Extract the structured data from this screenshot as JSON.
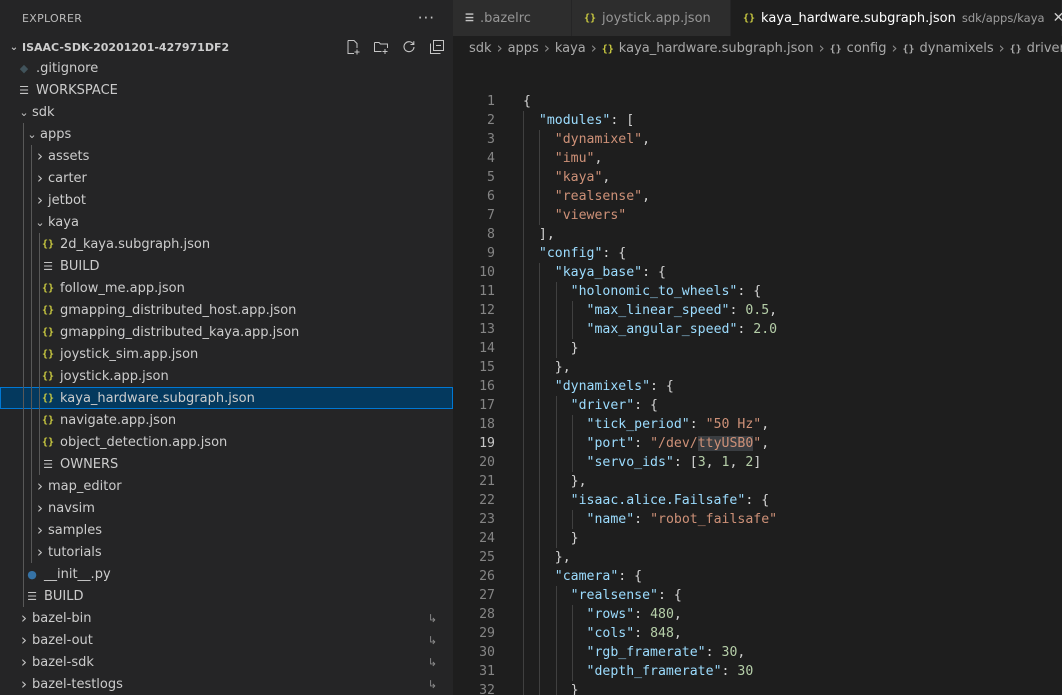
{
  "explorer": {
    "title": "EXPLORER",
    "more_icon": "ellipsis-icon",
    "root": "ISAAC-SDK-20201201-427971DF2",
    "actions": [
      "new-file-icon",
      "new-folder-icon",
      "refresh-icon",
      "collapse-all-icon"
    ],
    "items": [
      {
        "label": ".gitignore",
        "depth": 1,
        "type": "file",
        "icon": "git"
      },
      {
        "label": "WORKSPACE",
        "depth": 1,
        "type": "file",
        "icon": "lines"
      },
      {
        "label": "sdk",
        "depth": 1,
        "type": "folder-open"
      },
      {
        "label": "apps",
        "depth": 2,
        "type": "folder-open"
      },
      {
        "label": "assets",
        "depth": 3,
        "type": "folder"
      },
      {
        "label": "carter",
        "depth": 3,
        "type": "folder"
      },
      {
        "label": "jetbot",
        "depth": 3,
        "type": "folder"
      },
      {
        "label": "kaya",
        "depth": 3,
        "type": "folder-open"
      },
      {
        "label": "2d_kaya.subgraph.json",
        "depth": 4,
        "type": "file",
        "icon": "json"
      },
      {
        "label": "BUILD",
        "depth": 4,
        "type": "file",
        "icon": "lines"
      },
      {
        "label": "follow_me.app.json",
        "depth": 4,
        "type": "file",
        "icon": "json"
      },
      {
        "label": "gmapping_distributed_host.app.json",
        "depth": 4,
        "type": "file",
        "icon": "json"
      },
      {
        "label": "gmapping_distributed_kaya.app.json",
        "depth": 4,
        "type": "file",
        "icon": "json"
      },
      {
        "label": "joystick_sim.app.json",
        "depth": 4,
        "type": "file",
        "icon": "json"
      },
      {
        "label": "joystick.app.json",
        "depth": 4,
        "type": "file",
        "icon": "json"
      },
      {
        "label": "kaya_hardware.subgraph.json",
        "depth": 4,
        "type": "file",
        "icon": "json",
        "selected": true
      },
      {
        "label": "navigate.app.json",
        "depth": 4,
        "type": "file",
        "icon": "json"
      },
      {
        "label": "object_detection.app.json",
        "depth": 4,
        "type": "file",
        "icon": "json"
      },
      {
        "label": "OWNERS",
        "depth": 4,
        "type": "file",
        "icon": "lines"
      },
      {
        "label": "map_editor",
        "depth": 3,
        "type": "folder"
      },
      {
        "label": "navsim",
        "depth": 3,
        "type": "folder"
      },
      {
        "label": "samples",
        "depth": 3,
        "type": "folder"
      },
      {
        "label": "tutorials",
        "depth": 3,
        "type": "folder"
      },
      {
        "label": "__init__.py",
        "depth": 2,
        "type": "file",
        "icon": "py"
      },
      {
        "label": "BUILD",
        "depth": 2,
        "type": "file",
        "icon": "lines"
      },
      {
        "label": "bazel-bin",
        "depth": 1,
        "type": "folder",
        "link": true
      },
      {
        "label": "bazel-out",
        "depth": 1,
        "type": "folder",
        "link": true
      },
      {
        "label": "bazel-sdk",
        "depth": 1,
        "type": "folder",
        "link": true
      },
      {
        "label": "bazel-testlogs",
        "depth": 1,
        "type": "folder",
        "link": true
      }
    ]
  },
  "tabs": [
    {
      "label": ".bazelrc",
      "icon": "lines",
      "active": false
    },
    {
      "label": "joystick.app.json",
      "icon": "json",
      "active": false
    },
    {
      "label": "kaya_hardware.subgraph.json",
      "icon": "json",
      "active": true,
      "description": "sdk/apps/kaya"
    }
  ],
  "breadcrumb": [
    {
      "label": "sdk"
    },
    {
      "label": "apps"
    },
    {
      "label": "kaya"
    },
    {
      "label": "kaya_hardware.subgraph.json",
      "icon": "{}"
    },
    {
      "label": "config",
      "icon": "{}",
      "sym": true
    },
    {
      "label": "dynamixels",
      "icon": "{}",
      "sym": true
    },
    {
      "label": "driver",
      "icon": "{}",
      "sym": true
    }
  ],
  "current_line": 19,
  "code": [
    [
      [
        "p",
        "{"
      ]
    ],
    [
      [
        "p",
        "  "
      ],
      [
        "k",
        "\"modules\""
      ],
      [
        "p",
        ": ["
      ]
    ],
    [
      [
        "p",
        "    "
      ],
      [
        "s",
        "\"dynamixel\""
      ],
      [
        "p",
        ","
      ]
    ],
    [
      [
        "p",
        "    "
      ],
      [
        "s",
        "\"imu\""
      ],
      [
        "p",
        ","
      ]
    ],
    [
      [
        "p",
        "    "
      ],
      [
        "s",
        "\"kaya\""
      ],
      [
        "p",
        ","
      ]
    ],
    [
      [
        "p",
        "    "
      ],
      [
        "s",
        "\"realsense\""
      ],
      [
        "p",
        ","
      ]
    ],
    [
      [
        "p",
        "    "
      ],
      [
        "s",
        "\"viewers\""
      ]
    ],
    [
      [
        "p",
        "  ],"
      ]
    ],
    [
      [
        "p",
        "  "
      ],
      [
        "k",
        "\"config\""
      ],
      [
        "p",
        ": {"
      ]
    ],
    [
      [
        "p",
        "    "
      ],
      [
        "k",
        "\"kaya_base\""
      ],
      [
        "p",
        ": {"
      ]
    ],
    [
      [
        "p",
        "      "
      ],
      [
        "k",
        "\"holonomic_to_wheels\""
      ],
      [
        "p",
        ": {"
      ]
    ],
    [
      [
        "p",
        "        "
      ],
      [
        "k",
        "\"max_linear_speed\""
      ],
      [
        "p",
        ": "
      ],
      [
        "n",
        "0.5"
      ],
      [
        "p",
        ","
      ]
    ],
    [
      [
        "p",
        "        "
      ],
      [
        "k",
        "\"max_angular_speed\""
      ],
      [
        "p",
        ": "
      ],
      [
        "n",
        "2.0"
      ]
    ],
    [
      [
        "p",
        "      }"
      ]
    ],
    [
      [
        "p",
        "    },"
      ]
    ],
    [
      [
        "p",
        "    "
      ],
      [
        "k",
        "\"dynamixels\""
      ],
      [
        "p",
        ": {"
      ]
    ],
    [
      [
        "p",
        "      "
      ],
      [
        "k",
        "\"driver\""
      ],
      [
        "p",
        ": {"
      ]
    ],
    [
      [
        "p",
        "        "
      ],
      [
        "k",
        "\"tick_period\""
      ],
      [
        "p",
        ": "
      ],
      [
        "s",
        "\"50 Hz\""
      ],
      [
        "p",
        ","
      ]
    ],
    [
      [
        "p",
        "        "
      ],
      [
        "k",
        "\"port\""
      ],
      [
        "p",
        ": "
      ],
      [
        "s",
        "\"/dev/"
      ],
      [
        "hl",
        "ttyUSB0"
      ],
      [
        "s",
        "\""
      ],
      [
        "p",
        ","
      ]
    ],
    [
      [
        "p",
        "        "
      ],
      [
        "k",
        "\"servo_ids\""
      ],
      [
        "p",
        ": ["
      ],
      [
        "n",
        "3"
      ],
      [
        "p",
        ", "
      ],
      [
        "n",
        "1"
      ],
      [
        "p",
        ", "
      ],
      [
        "n",
        "2"
      ],
      [
        "p",
        "]"
      ]
    ],
    [
      [
        "p",
        "      },"
      ]
    ],
    [
      [
        "p",
        "      "
      ],
      [
        "k",
        "\"isaac.alice.Failsafe\""
      ],
      [
        "p",
        ": {"
      ]
    ],
    [
      [
        "p",
        "        "
      ],
      [
        "k",
        "\"name\""
      ],
      [
        "p",
        ": "
      ],
      [
        "s",
        "\"robot_failsafe\""
      ]
    ],
    [
      [
        "p",
        "      }"
      ]
    ],
    [
      [
        "p",
        "    },"
      ]
    ],
    [
      [
        "p",
        "    "
      ],
      [
        "k",
        "\"camera\""
      ],
      [
        "p",
        ": {"
      ]
    ],
    [
      [
        "p",
        "      "
      ],
      [
        "k",
        "\"realsense\""
      ],
      [
        "p",
        ": {"
      ]
    ],
    [
      [
        "p",
        "        "
      ],
      [
        "k",
        "\"rows\""
      ],
      [
        "p",
        ": "
      ],
      [
        "n",
        "480"
      ],
      [
        "p",
        ","
      ]
    ],
    [
      [
        "p",
        "        "
      ],
      [
        "k",
        "\"cols\""
      ],
      [
        "p",
        ": "
      ],
      [
        "n",
        "848"
      ],
      [
        "p",
        ","
      ]
    ],
    [
      [
        "p",
        "        "
      ],
      [
        "k",
        "\"rgb_framerate\""
      ],
      [
        "p",
        ": "
      ],
      [
        "n",
        "30"
      ],
      [
        "p",
        ","
      ]
    ],
    [
      [
        "p",
        "        "
      ],
      [
        "k",
        "\"depth_framerate\""
      ],
      [
        "p",
        ": "
      ],
      [
        "n",
        "30"
      ]
    ],
    [
      [
        "p",
        "      }"
      ]
    ]
  ]
}
